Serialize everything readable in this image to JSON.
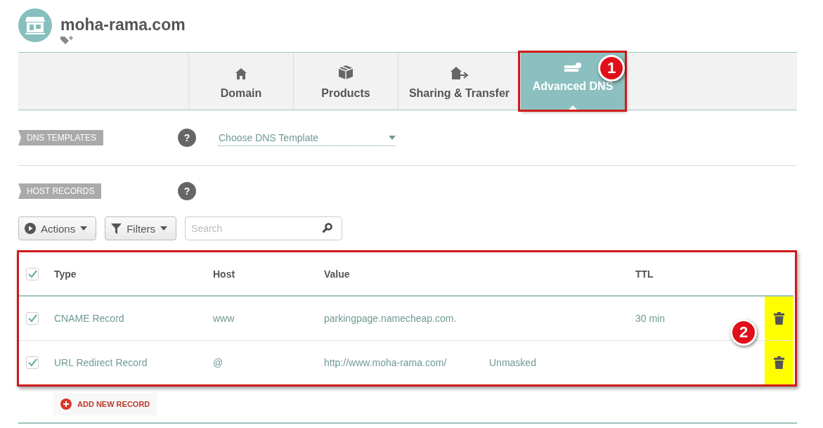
{
  "domain": {
    "title": "moha-rama.com"
  },
  "tabs": [
    {
      "label": "Domain",
      "selected": false,
      "highlighted": false
    },
    {
      "label": "Products",
      "selected": false,
      "highlighted": false
    },
    {
      "label": "Sharing & Transfer",
      "selected": false,
      "highlighted": false
    },
    {
      "label": "Advanced DNS",
      "selected": true,
      "highlighted": true,
      "callout": "1"
    }
  ],
  "dns_templates": {
    "label": "DNS TEMPLATES",
    "help": "?",
    "dropdown": {
      "value": "Choose DNS Template"
    }
  },
  "host_records": {
    "label": "HOST RECORDS",
    "help": "?"
  },
  "toolbar": {
    "actions": "Actions",
    "filters": "Filters",
    "search": {
      "placeholder": "Search"
    }
  },
  "table": {
    "highlighted": true,
    "callout": "2",
    "all_checked": true,
    "columns": [
      "Type",
      "Host",
      "Value",
      "TTL"
    ],
    "rows": [
      {
        "checked": true,
        "type": "CNAME Record",
        "host": "www",
        "value": "parkingpage.namecheap.com.",
        "column_4": "",
        "ttl": "30 min",
        "delete_highlighted": true
      },
      {
        "checked": true,
        "type": "URL Redirect Record",
        "host": "@",
        "value": "http://www.moha-rama.com/",
        "column_4": "Unmasked",
        "ttl": "",
        "delete_highlighted": true
      }
    ]
  },
  "add_button": "ADD NEW RECORD"
}
